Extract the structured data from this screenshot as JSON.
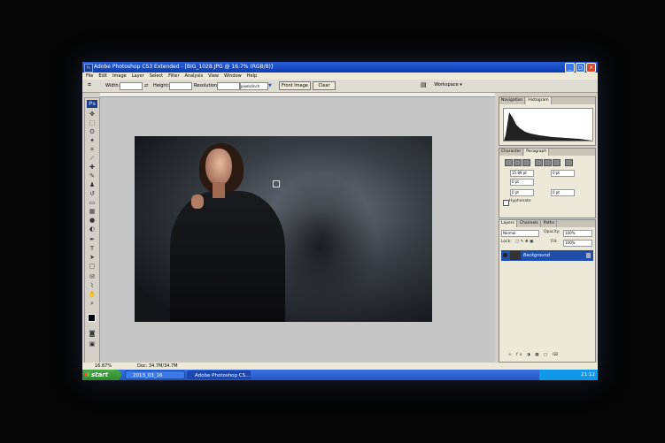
{
  "window": {
    "title": "Adobe Photoshop CS3 Extended - [BIG_1028.JPG @ 16.7% (RGB/8)]",
    "controls": {
      "minimize": "_",
      "maximize": "□",
      "close": "×"
    }
  },
  "menu": [
    "File",
    "Edit",
    "Image",
    "Layer",
    "Select",
    "Filter",
    "Analysis",
    "View",
    "Window",
    "Help"
  ],
  "options_bar": {
    "width_label": "Width:",
    "height_label": "Height:",
    "resolution_label": "Resolution:",
    "resolution_unit": "pixels/inch",
    "front_image_label": "Front Image",
    "clear_label": "Clear",
    "workspace_label": "Workspace ▾"
  },
  "panels": {
    "top_tabs": [
      "Navigation",
      "Histogram"
    ],
    "character_tabs": [
      "Character",
      "Paragraph"
    ],
    "paragraph": {
      "indent_left": "15.89 pt",
      "indent_right": "0 pt",
      "first_line": "0 pt",
      "space_before": "0 pt",
      "space_after": "0 pt",
      "hyphenate": "Hyphenate"
    },
    "layer_tabs": [
      "Layers",
      "Channels",
      "Paths"
    ],
    "blend_mode": "Normal",
    "opacity_label": "Opacity:",
    "opacity_value": "100%",
    "lock_label": "Lock:",
    "fill_label": "Fill:",
    "fill_value": "100%",
    "layer_name": "Background"
  },
  "status": {
    "zoom": "16.67%",
    "doc": "Doc: 34.7M/34.7M"
  },
  "taskbar": {
    "start": "start",
    "tasks": [
      "2013_03_16",
      "Adobe Photoshop CS..."
    ],
    "clock": "21:12"
  },
  "icons": {
    "tools": [
      "move-icon",
      "marquee-icon",
      "lasso-icon",
      "magic-wand-icon",
      "crop-icon",
      "slice-icon",
      "healing-icon",
      "brush-icon",
      "stamp-icon",
      "history-brush-icon",
      "eraser-icon",
      "gradient-icon",
      "blur-icon",
      "dodge-icon",
      "pen-icon",
      "type-icon",
      "path-select-icon",
      "shape-icon",
      "notes-icon",
      "eyedropper-icon",
      "hand-icon",
      "zoom-icon"
    ]
  },
  "colors": {
    "titlebar": "#0a3bb0",
    "taskbar": "#2456c8",
    "start": "#2e8a2e",
    "layer_selected": "#1f4ea8"
  }
}
